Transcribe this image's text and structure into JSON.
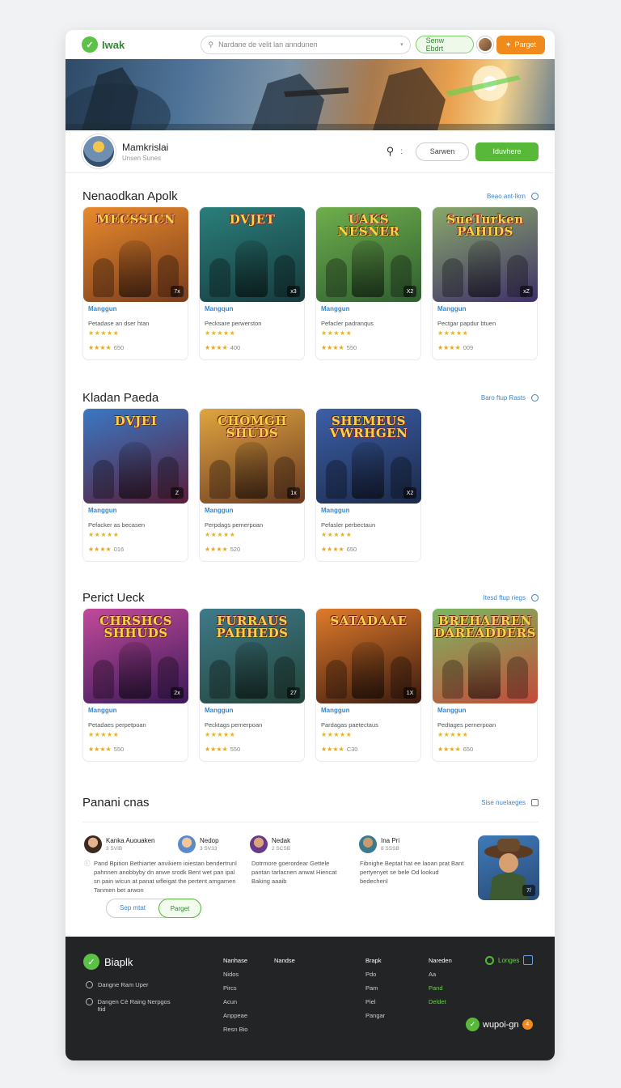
{
  "topbar": {
    "logo_text": "Iwak",
    "search_placeholder": "Nardane de velit lan anndunen",
    "outline_button": "Senw Ebdrt",
    "orange_button": "Parget"
  },
  "hero": {
    "alt": ""
  },
  "profile": {
    "name": "Mamkrislai",
    "sub": "Unsen Sunes",
    "ghost_button": "Sarwen",
    "green_button": "Iduvhere"
  },
  "sections": [
    {
      "title": "Nenaodkan Apolk",
      "link": "Beao ant-Ikrn",
      "cards": [
        {
          "thumb_title": "MECSSICN",
          "badge": "7x",
          "name": "Manggun",
          "desc": "Petadase an dser htan",
          "stars1": "★★★★★",
          "stars2": "★★★★",
          "count": "650",
          "palette": [
            "#e88a2c",
            "#7a3c1d"
          ]
        },
        {
          "thumb_title": "DVJET",
          "badge": "x3",
          "name": "Mangqun",
          "desc": "Pecksare perwerston",
          "stars1": "★★★★★",
          "stars2": "★★★★",
          "count": "400",
          "palette": [
            "#2a7f7b",
            "#173a3d"
          ]
        },
        {
          "thumb_title": "UAKS NESNER",
          "badge": "X2",
          "name": "Manggun",
          "desc": "Pefacler padranqus",
          "stars1": "★★★★★",
          "stars2": "★★★★",
          "count": "550",
          "palette": [
            "#6fae4c",
            "#2f5e31"
          ]
        },
        {
          "thumb_title": "SueTurken PAHIDS",
          "badge": "xZ",
          "name": "Manggun",
          "desc": "Pectgar papdur btuen",
          "stars1": "★★★★★",
          "stars2": "★★★★",
          "count": "009",
          "palette": [
            "#88a86a",
            "#40306a"
          ]
        }
      ]
    },
    {
      "title": "Kladan Paeda",
      "link": "Baro ftup Rasts",
      "cards": [
        {
          "thumb_title": "DVJEI",
          "badge": "Z",
          "name": "Manggun",
          "desc": "Pefacker as becasen",
          "stars1": "★★★★★",
          "stars2": "★★★★",
          "count": "016",
          "palette": [
            "#3a78c4",
            "#5a1e3a"
          ]
        },
        {
          "thumb_title": "CHOMGH SHUDS",
          "badge": "1x",
          "name": "Manggun",
          "desc": "Perpdags pemerpoan",
          "stars1": "★★★★★",
          "stars2": "★★★★",
          "count": "520",
          "palette": [
            "#e0a540",
            "#6a3a22"
          ]
        },
        {
          "thumb_title": "SHEMEUS VWRHGEN",
          "badge": "X2",
          "name": "Manggun",
          "desc": "Pefasler perbectaun",
          "stars1": "★★★★★",
          "stars2": "★★★★",
          "count": "650",
          "palette": [
            "#3c5fa8",
            "#1c2a4a"
          ]
        }
      ]
    },
    {
      "title": "Perict Ueck",
      "link": "Itesd ftup riegs",
      "cards": [
        {
          "thumb_title": "CHRSHCS SHHUDS",
          "badge": "2x",
          "name": "Manggun",
          "desc": "Petadaes perpetpoan",
          "stars1": "★★★★★",
          "stars2": "★★★★",
          "count": "550",
          "palette": [
            "#c24a9a",
            "#3a1a5a"
          ]
        },
        {
          "thumb_title": "FURRAUS PAHHEDS",
          "badge": "27",
          "name": "Manggun",
          "desc": "Pecktags pernerpoan",
          "stars1": "★★★★★",
          "stars2": "★★★★",
          "count": "550",
          "palette": [
            "#3f7a8a",
            "#23453a"
          ]
        },
        {
          "thumb_title": "SATADAAE",
          "badge": "1X",
          "name": "Manggun",
          "desc": "Pardagas paetectaus",
          "stars1": "★★★★★",
          "stars2": "★★★★",
          "count": "C30",
          "palette": [
            "#e07b2a",
            "#3a1a10"
          ]
        },
        {
          "thumb_title": "BREHAEREN DAREADDERS",
          "badge": "",
          "name": "Manggun",
          "desc": "Pedtages pernerpoan",
          "stars1": "★★★★★",
          "stars2": "★★★★",
          "count": "650",
          "palette": [
            "#7ab860",
            "#c44a3a"
          ]
        }
      ]
    }
  ],
  "reviews": {
    "title": "Panani cnas",
    "link": "Sise nuelaeges",
    "reviewers": [
      {
        "name": "Kanka Auouaken",
        "date": "3 SVIB"
      },
      {
        "name": "Nedop",
        "date": "3 SV33"
      },
      {
        "name": "Nedak",
        "date": "2 SCSB"
      },
      {
        "name": "Ina Pri",
        "date": "8 SSSB"
      }
    ],
    "texts": [
      "Pand Bpition Bethiarter anvikiem ioiestan bendertrunl pahnnen anobbyby dn anwe srodk Bent wet pan ipal sn pain wicun at panat wfleigat the pertent amgamen Tanmen bet arwon",
      "Dotrmore goerordear Gettele pantan tarlacnen anwat Hiencat Baking aaaib",
      "Fibnighe Beptat hat ee laoan prat Bant pertyenyet se bele Od lookud bedechenl"
    ],
    "button_left": "Sep mtat",
    "button_right": "Parget"
  },
  "footer": {
    "logo": "Biaplk",
    "notes": [
      "Dangne Ram Uper",
      "Dangen Cè Raing Nerpgos Itid"
    ],
    "col1": {
      "head": "Nanhase",
      "items": [
        "Nidos",
        "Pircs",
        "Acun",
        "Anppeae",
        "Resn Bio"
      ]
    },
    "col2": {
      "head": "Nandse"
    },
    "col3": {
      "head": "Brapk",
      "items": [
        "Pdo",
        "Pam",
        "Piel",
        "Pangar"
      ]
    },
    "col4": {
      "head": "Nareden",
      "items": [
        "Aa",
        "Pand",
        "Deldet"
      ]
    },
    "badge": "Longes",
    "brand": "wupoi-gn"
  }
}
